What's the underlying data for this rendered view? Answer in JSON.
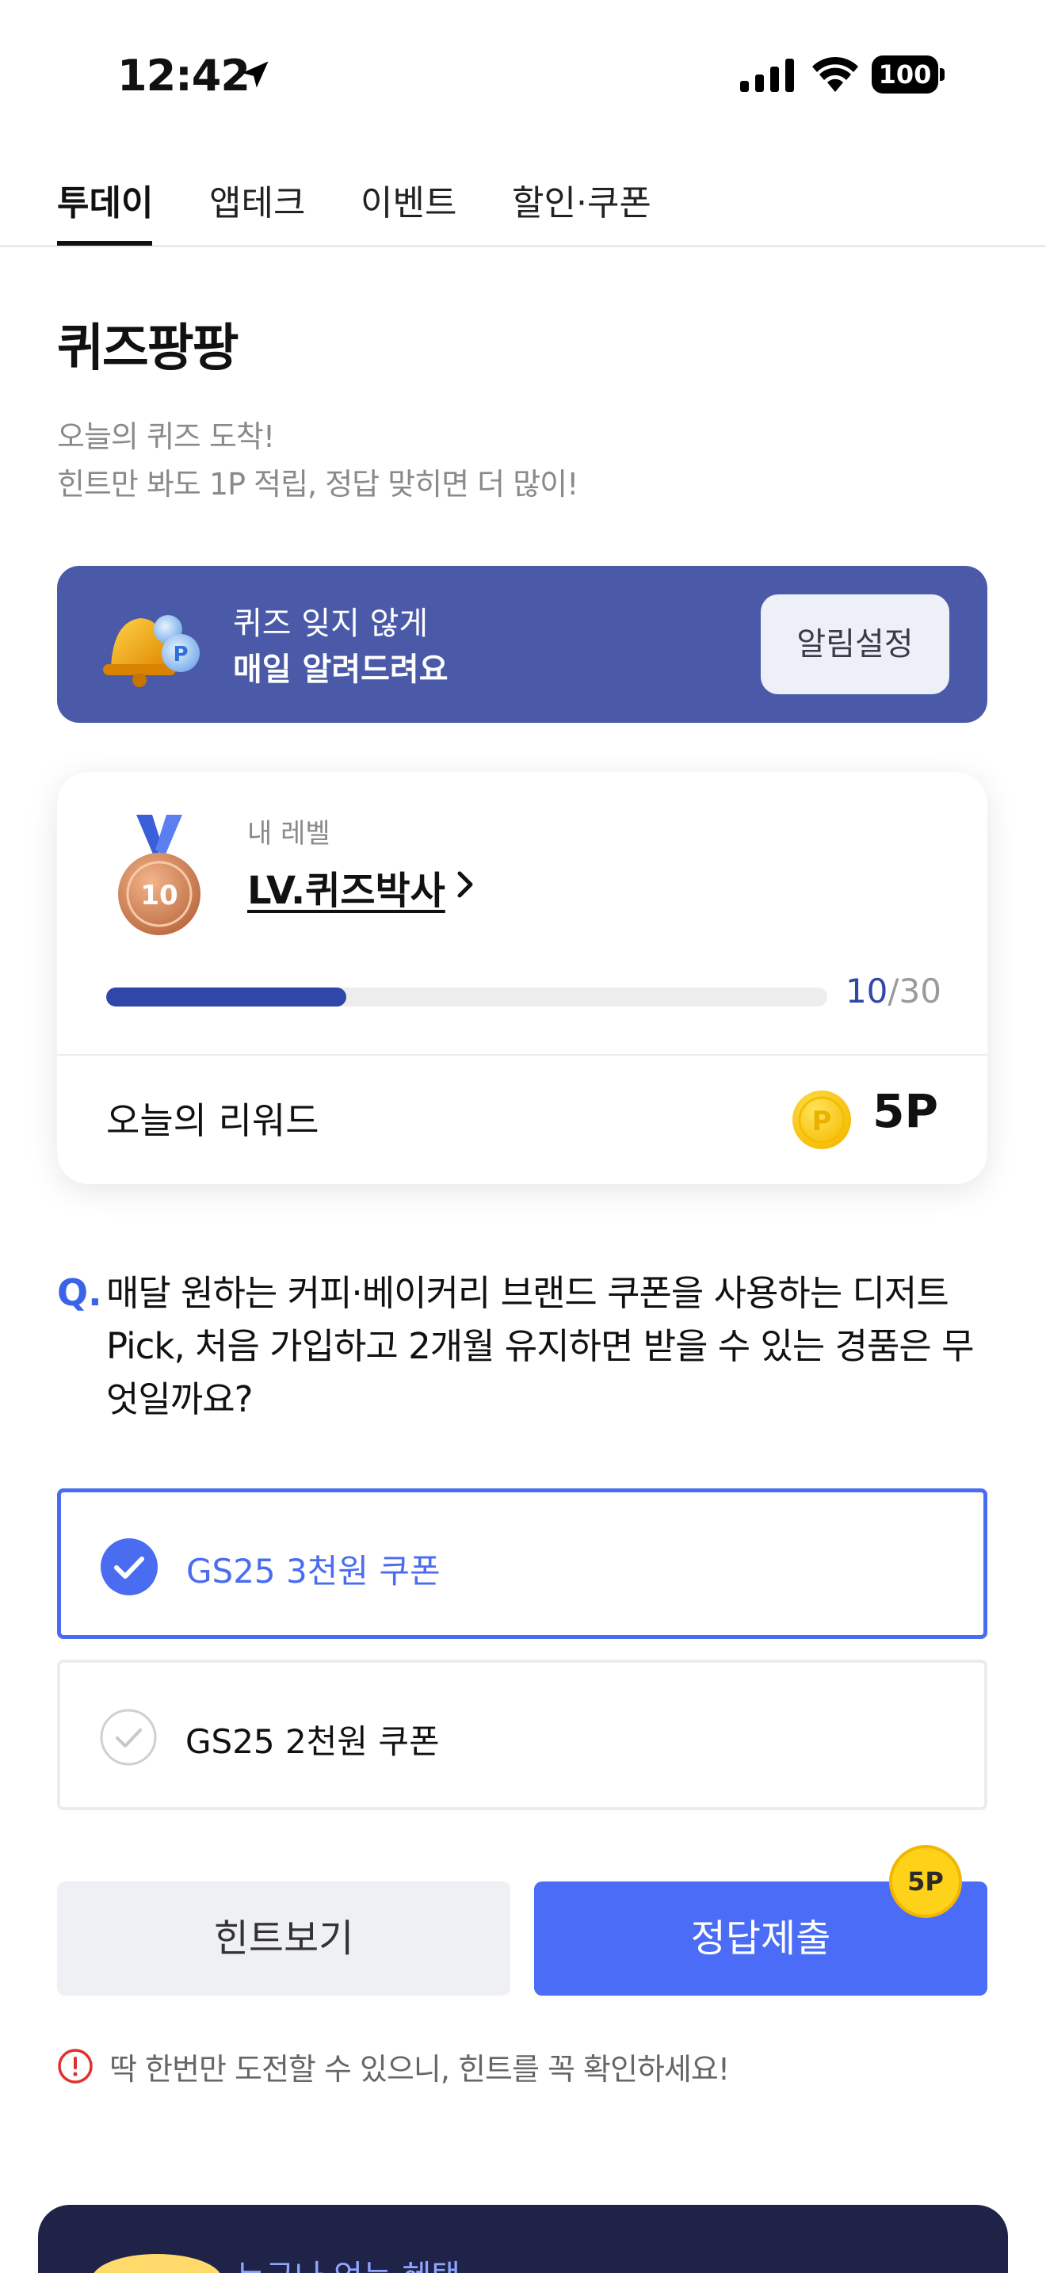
{
  "status_bar": {
    "time": "12:42",
    "battery": "100"
  },
  "tabs": [
    {
      "label": "투데이",
      "active": true
    },
    {
      "label": "앱테크",
      "active": false
    },
    {
      "label": "이벤트",
      "active": false
    },
    {
      "label": "할인·쿠폰",
      "active": false
    }
  ],
  "header": {
    "title": "퀴즈팡팡",
    "subtitle_line1": "오늘의 퀴즈 도착!",
    "subtitle_line2": "힌트만 봐도 1P 적립, 정답 맞히면 더 많이!"
  },
  "notify_banner": {
    "line1": "퀴즈 잊지 않게",
    "line2": "매일 알려드려요",
    "button_label": "알림설정"
  },
  "level_card": {
    "medal_number": "10",
    "caption": "내 레벨",
    "level_name": "LV.퀴즈박사",
    "progress_current": "10",
    "progress_total": "/30",
    "progress_fraction": 0.333,
    "reward_label": "오늘의 리워드",
    "reward_value": "5P"
  },
  "question": {
    "mark": "Q.",
    "text": "매달 원하는 커피·베이커리 브랜드 쿠폰을 사용하는 디저트Pick, 처음 가입하고 2개월 유지하면 받을 수 있는 경품은 무엇일까요?"
  },
  "options": [
    {
      "label": "GS25 3천원 쿠폰",
      "selected": true
    },
    {
      "label": "GS25 2천원 쿠폰",
      "selected": false
    }
  ],
  "buttons": {
    "hint_label": "힌트보기",
    "submit_label": "정답제출",
    "submit_badge": "5P"
  },
  "warning": {
    "text": "딱 한번만 도전할 수 있으니, 힌트를 꼭 확인하세요!"
  },
  "promo": {
    "text": "누구나 얻는 혜택"
  },
  "colors": {
    "accent": "#4a6cf6",
    "banner": "#4a5aa8",
    "progress": "#2f47a8",
    "promo_bg": "#1f2347"
  }
}
